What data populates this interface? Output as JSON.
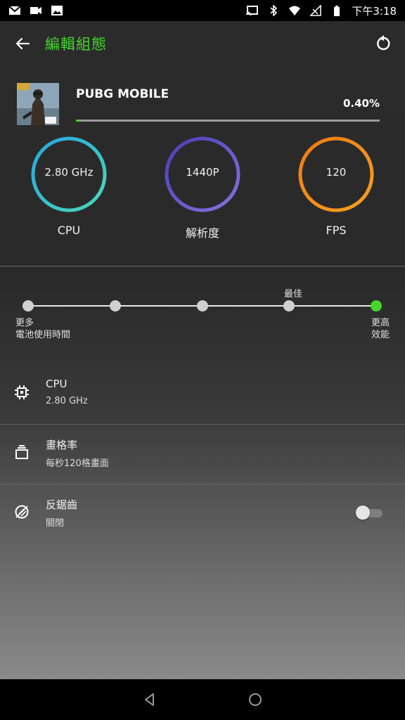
{
  "status_bar": {
    "time": "下午3:18",
    "left_icons": [
      "gmail-icon",
      "video-camera-icon",
      "image-icon"
    ],
    "right_icons": [
      "cast-icon",
      "bluetooth-icon",
      "wifi-icon",
      "no-signal-icon",
      "battery-icon"
    ]
  },
  "header": {
    "title": "編輯組態",
    "back_icon": "arrow-left-icon",
    "reset_icon": "reset-icon"
  },
  "game": {
    "name": "PUBG MOBILE",
    "percent": "0.40%",
    "progress_fraction": 0.004
  },
  "gauges": [
    {
      "value": "2.80 GHz",
      "label": "CPU",
      "color_start": "#27a6e0",
      "color_end": "#4ad8b8"
    },
    {
      "value": "1440P",
      "label": "解析度",
      "color_start": "#4a3db8",
      "color_end": "#8a70e0"
    },
    {
      "value": "120",
      "label": "FPS",
      "color_start": "#f07a10",
      "color_end": "#f6a020"
    }
  ],
  "performance_slider": {
    "steps": 5,
    "selected_index": 4,
    "best_label": "最佳",
    "left_label_line1": "更多",
    "left_label_line2": "電池使用時間",
    "right_label_line1": "更高",
    "right_label_line2": "效能"
  },
  "settings": [
    {
      "title": "CPU",
      "subtitle": "2.80 GHz",
      "icon": "cpu-chip-icon"
    },
    {
      "title": "畫格率",
      "subtitle": "每秒120格畫面",
      "icon": "frame-rate-icon"
    },
    {
      "title": "反鋸齒",
      "subtitle": "關閉",
      "icon": "anti-aliasing-icon",
      "toggle_on": false
    }
  ],
  "colors": {
    "accent": "#44d62c",
    "background": "#2b2b2b"
  },
  "nav": {
    "icons": [
      "back-triangle-icon",
      "home-circle-icon"
    ]
  }
}
